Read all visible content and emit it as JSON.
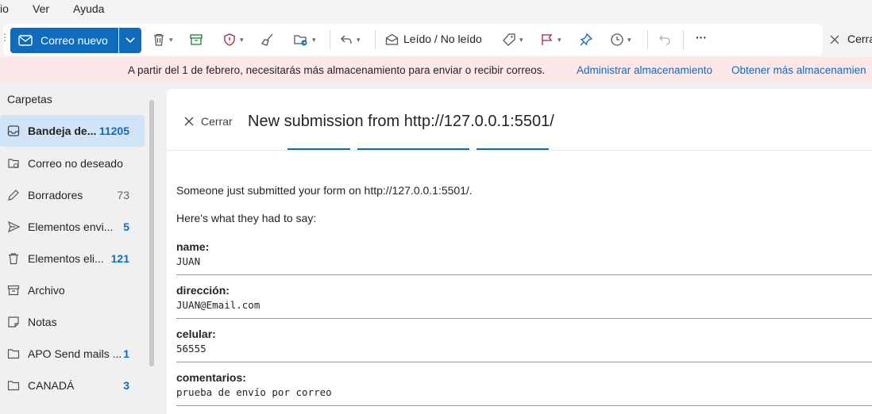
{
  "menu": {
    "items": [
      "io",
      "Ver",
      "Ayuda"
    ]
  },
  "toolbar": {
    "new_mail_label": "Correo nuevo",
    "read_unread_label": "Leído / No leído",
    "close_label": "Cerra",
    "more_label": "···",
    "icons": [
      "delete-icon",
      "archive-icon",
      "report-icon",
      "sweep-icon",
      "move-icon",
      "reply-icon",
      "envelope-icon",
      "tag-icon",
      "flag-icon",
      "pin-icon",
      "snooze-icon",
      "undo-icon"
    ]
  },
  "banner": {
    "message": "A partir del 1 de febrero, necesitarás más almacenamiento para enviar o recibir correos.",
    "link1": "Administrar almacenamiento",
    "link2": "Obtener más almacenamien"
  },
  "folders": {
    "title": "Carpetas",
    "items": [
      {
        "label": "Bandeja de...",
        "count": "11205",
        "icon": "inbox-icon"
      },
      {
        "label": "Correo no deseado",
        "count": "",
        "icon": "junk-icon"
      },
      {
        "label": "Borradores",
        "count": "73",
        "icon": "drafts-icon"
      },
      {
        "label": "Elementos envi...",
        "count": "5",
        "icon": "sent-icon"
      },
      {
        "label": "Elementos eli...",
        "count": "121",
        "icon": "trash-icon"
      },
      {
        "label": "Archivo",
        "count": "",
        "icon": "archive-icon"
      },
      {
        "label": "Notas",
        "count": "",
        "icon": "notes-icon"
      },
      {
        "label": "APO Send mails ...",
        "count": "1",
        "icon": "folder-icon"
      },
      {
        "label": "CANADÁ",
        "count": "3",
        "icon": "folder-icon"
      }
    ]
  },
  "message": {
    "close_label": "Cerrar",
    "subject": "New submission from http://127.0.0.1:5501/",
    "intro": "Someone just submitted your form on http://127.0.0.1:5501/.",
    "lead": "Here's what they had to say:",
    "fields": [
      {
        "label": "name:",
        "value": "JUAN"
      },
      {
        "label": "dirección:",
        "value": "JUAN@Email.com"
      },
      {
        "label": "celular:",
        "value": "56555"
      },
      {
        "label": "comentarios:",
        "value": "prueba de envío por correo"
      }
    ]
  },
  "colors": {
    "accent": "#0f6cbd",
    "banner_bg": "#fde7e9",
    "selected_folder": "#d1e4f7"
  }
}
